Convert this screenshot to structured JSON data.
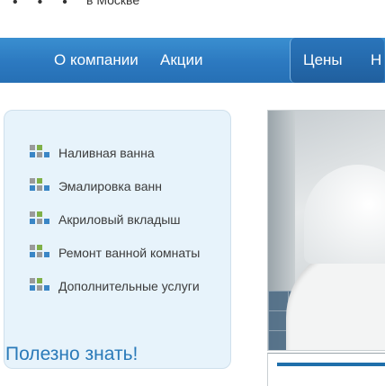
{
  "top": {
    "city": "в Москве"
  },
  "nav": {
    "items": [
      {
        "label": "О компании"
      },
      {
        "label": "Акции"
      },
      {
        "label": "Цены"
      },
      {
        "label": "Н"
      }
    ]
  },
  "services": [
    {
      "label": "Наливная ванна",
      "icon": "tiles-icon"
    },
    {
      "label": "Эмалировка ванн",
      "icon": "tiles-icon"
    },
    {
      "label": "Акриловый вкладыш",
      "icon": "tiles-icon"
    },
    {
      "label": "Ремонт ванной комнаты",
      "icon": "tiles-icon"
    },
    {
      "label": "Дополнительные услуги",
      "icon": "tiles-icon"
    }
  ],
  "section": {
    "heading": "Полезно знать!"
  },
  "colors": {
    "nav": "#2c79c0",
    "panel_bg": "#e7f3fb",
    "heading": "#2a7ab9",
    "icon_green": "#7fb048",
    "icon_blue": "#3a86c6",
    "icon_gray": "#9a9a9a"
  }
}
